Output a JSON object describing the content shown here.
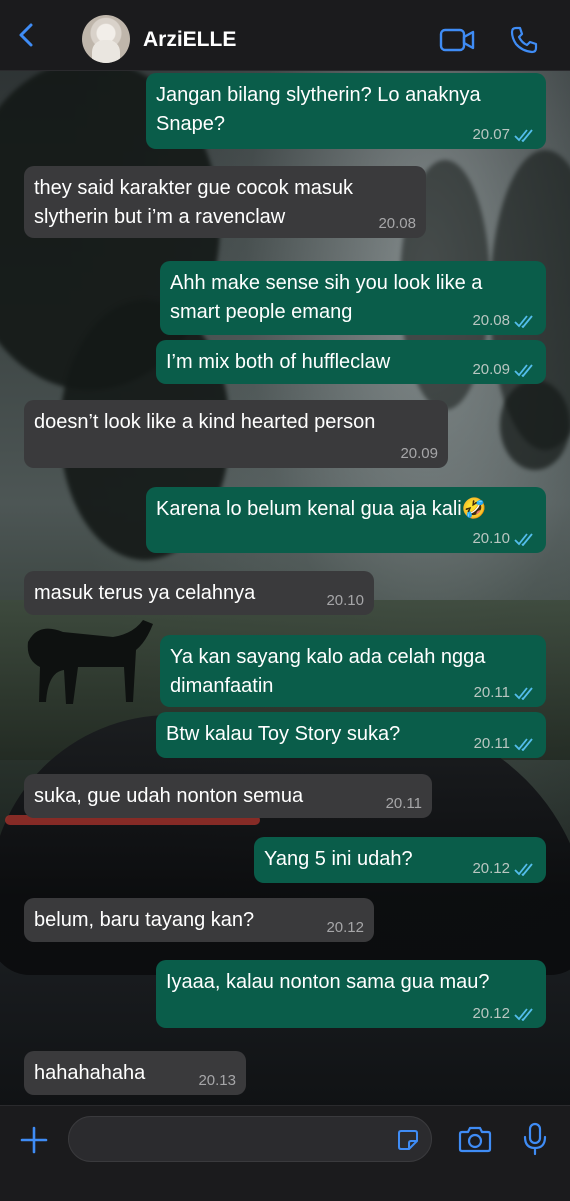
{
  "colors": {
    "accent": "#3f8cf5",
    "outgoing": "#0a5d4a",
    "incoming": "#3a3a3c",
    "read_ticks": "#53bdeb"
  },
  "header": {
    "back_icon": "chevron-left-icon",
    "contact_name": "ArziELLE",
    "video_icon": "video-call-icon",
    "call_icon": "phone-icon"
  },
  "messages": [
    {
      "dir": "out",
      "text": "Jangan bilang slytherin? Lo anaknya\nSnape?",
      "time": "20.07",
      "read": true
    },
    {
      "dir": "in",
      "text": "they said karakter gue cocok masuk\nslytherin but i’m a ravenclaw",
      "time": "20.08"
    },
    {
      "dir": "out",
      "text": "Ahh make sense sih you look like a\nsmart people emang",
      "time": "20.08",
      "read": true
    },
    {
      "dir": "out",
      "text": "I’m mix both of huffleclaw",
      "time": "20.09",
      "read": true
    },
    {
      "dir": "in",
      "text": "doesn’t look like a kind hearted person",
      "time": "20.09"
    },
    {
      "dir": "out",
      "text": "Karena lo belum kenal gua aja kali🤣",
      "time": "20.10",
      "read": true
    },
    {
      "dir": "in",
      "text": "masuk terus ya celahnya",
      "time": "20.10"
    },
    {
      "dir": "out",
      "text": "Ya kan sayang kalo ada celah ngga\ndimanfaatin",
      "time": "20.11",
      "read": true
    },
    {
      "dir": "out",
      "text": "Btw kalau Toy Story suka?",
      "time": "20.11",
      "read": true
    },
    {
      "dir": "in",
      "text": "suka, gue udah nonton semua",
      "time": "20.11"
    },
    {
      "dir": "out",
      "text": "Yang 5 ini udah?",
      "time": "20.12",
      "read": true
    },
    {
      "dir": "in",
      "text": "belum, baru tayang kan?",
      "time": "20.12"
    },
    {
      "dir": "out",
      "text": "Iyaaa, kalau nonton sama gua mau?",
      "time": "20.12",
      "read": true
    },
    {
      "dir": "in",
      "text": "hahahahaha",
      "time": "20.13"
    }
  ],
  "footer": {
    "plus_icon": "plus-icon",
    "input_value": "",
    "sticker_icon": "sticker-icon",
    "camera_icon": "camera-icon",
    "mic_icon": "microphone-icon"
  }
}
